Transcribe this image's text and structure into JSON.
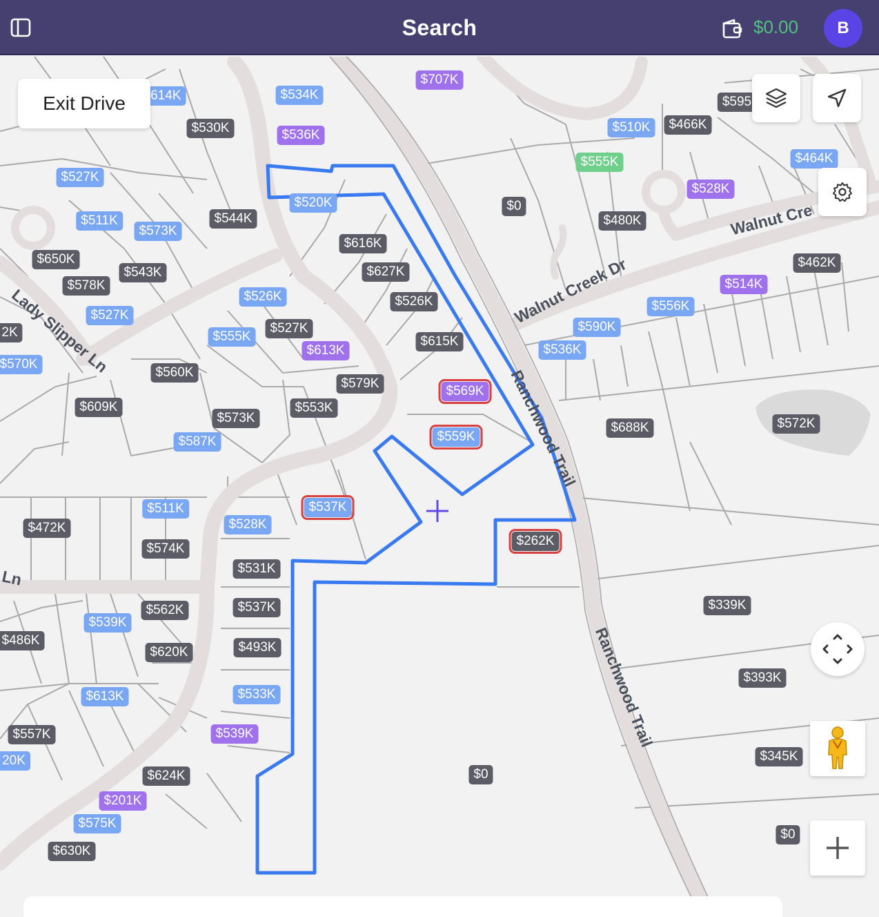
{
  "header": {
    "title": "Search",
    "balance": "$0.00",
    "avatar_initial": "B",
    "icons": [
      "sidebar-toggle-icon",
      "wallet-icon"
    ]
  },
  "controls": {
    "exit_drive_label": "Exit Drive",
    "icons": [
      "layers-icon",
      "navigation-arrow-icon",
      "settings-gear-icon",
      "recenter-icon",
      "street-view-pegman-icon",
      "zoom-in-icon"
    ]
  },
  "streets": {
    "walnut_creek_1": "Walnut Creek Dr",
    "walnut_creek_2": "Walnut Cre",
    "ranchwood_1": "Ranchwood Trail",
    "ranchwood_2": "Ranchwood Trail",
    "lady_slipper": "Lady Slipper Ln",
    "ln_fragment": "y Ln"
  },
  "colors": {
    "header_bg": "#45406f",
    "balance": "#4ec27a",
    "avatar": "#5a44e6",
    "polygon": "#3a7af0",
    "pin_gray": "#5c5c66",
    "pin_blue": "#7aa7f3",
    "pin_purple": "#a071ec",
    "pin_green": "#6fd08b",
    "selected_outline": "#d94040"
  },
  "prices": [
    {
      "label": "$614K",
      "color": "blue"
    },
    {
      "label": "$534K",
      "color": "blue"
    },
    {
      "label": "$707K",
      "color": "purple"
    },
    {
      "label": "$530K",
      "color": "gray"
    },
    {
      "label": "$536K",
      "color": "purple"
    },
    {
      "label": "$595",
      "color": "gray"
    },
    {
      "label": "$510K",
      "color": "blue"
    },
    {
      "label": "$466K",
      "color": "gray"
    },
    {
      "label": "$555K",
      "color": "green"
    },
    {
      "label": "$464K",
      "color": "blue"
    },
    {
      "label": "$527K",
      "color": "blue"
    },
    {
      "label": "$520K",
      "color": "blue"
    },
    {
      "label": "$0",
      "color": "gray"
    },
    {
      "label": "$528K",
      "color": "purple"
    },
    {
      "label": "$511K",
      "color": "blue"
    },
    {
      "label": "$573K",
      "color": "blue"
    },
    {
      "label": "$544K",
      "color": "gray"
    },
    {
      "label": "$480K",
      "color": "gray"
    },
    {
      "label": "$616K",
      "color": "gray"
    },
    {
      "label": "$650K",
      "color": "gray"
    },
    {
      "label": "$462K",
      "color": "gray"
    },
    {
      "label": "$543K",
      "color": "gray"
    },
    {
      "label": "$627K",
      "color": "gray"
    },
    {
      "label": "$578K",
      "color": "gray"
    },
    {
      "label": "$514K",
      "color": "purple"
    },
    {
      "label": "$526K",
      "color": "blue"
    },
    {
      "label": "$526K",
      "color": "gray"
    },
    {
      "label": "$556K",
      "color": "blue"
    },
    {
      "label": "$527K",
      "color": "blue"
    },
    {
      "label": "$590K",
      "color": "blue"
    },
    {
      "label": "$527K",
      "color": "gray"
    },
    {
      "label": "2K",
      "color": "gray"
    },
    {
      "label": "$555K",
      "color": "blue"
    },
    {
      "label": "$613K",
      "color": "purple"
    },
    {
      "label": "$615K",
      "color": "gray"
    },
    {
      "label": "$536K",
      "color": "blue"
    },
    {
      "label": "$570K",
      "color": "blue"
    },
    {
      "label": "$560K",
      "color": "gray"
    },
    {
      "label": "$579K",
      "color": "gray"
    },
    {
      "label": "$569K",
      "color": "purple",
      "selected": true
    },
    {
      "label": "$609K",
      "color": "gray"
    },
    {
      "label": "$553K",
      "color": "gray"
    },
    {
      "label": "$573K",
      "color": "gray"
    },
    {
      "label": "$688K",
      "color": "gray"
    },
    {
      "label": "$572K",
      "color": "gray"
    },
    {
      "label": "$559K",
      "color": "blue",
      "selected": true
    },
    {
      "label": "$587K",
      "color": "blue"
    },
    {
      "label": "$537K",
      "color": "blue",
      "selected": true
    },
    {
      "label": "$511K",
      "color": "blue"
    },
    {
      "label": "$528K",
      "color": "blue"
    },
    {
      "label": "$472K",
      "color": "gray"
    },
    {
      "label": "$574K",
      "color": "gray"
    },
    {
      "label": "$262K",
      "color": "gray",
      "selected": true
    },
    {
      "label": "$531K",
      "color": "gray"
    },
    {
      "label": "$339K",
      "color": "gray"
    },
    {
      "label": "$537K",
      "color": "gray"
    },
    {
      "label": "$562K",
      "color": "gray"
    },
    {
      "label": "$539K",
      "color": "blue"
    },
    {
      "label": "$486K",
      "color": "gray"
    },
    {
      "label": "$620K",
      "color": "gray"
    },
    {
      "label": "$493K",
      "color": "gray"
    },
    {
      "label": "$393K",
      "color": "gray"
    },
    {
      "label": "$613K",
      "color": "blue"
    },
    {
      "label": "$533K",
      "color": "blue"
    },
    {
      "label": "$557K",
      "color": "gray"
    },
    {
      "label": "$539K",
      "color": "purple"
    },
    {
      "label": "20K",
      "color": "blue"
    },
    {
      "label": "$345K",
      "color": "gray"
    },
    {
      "label": "$624K",
      "color": "gray"
    },
    {
      "label": "$0",
      "color": "gray"
    },
    {
      "label": "$201K",
      "color": "purple"
    },
    {
      "label": "$575K",
      "color": "blue"
    },
    {
      "label": "$630K",
      "color": "gray"
    },
    {
      "label": "$0",
      "color": "gray"
    }
  ]
}
